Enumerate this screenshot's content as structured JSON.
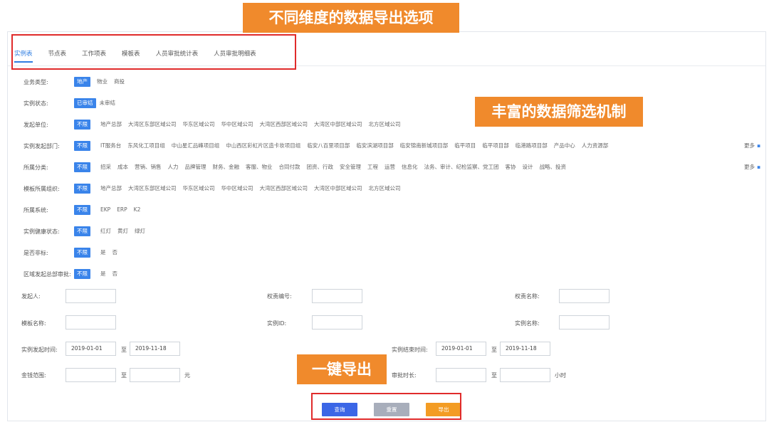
{
  "callouts": {
    "tabs_note": "不同维度的数据导出选项",
    "filter_note": "丰富的数据筛选机制",
    "export_note": "一键导出"
  },
  "tabs": [
    "实例表",
    "节点表",
    "工作项表",
    "模板表",
    "人员审批统计表",
    "人员审批明细表"
  ],
  "filters": {
    "business_type": {
      "label": "业务类型:",
      "options": [
        "地产",
        "物业",
        "商投"
      ]
    },
    "instance_status": {
      "label": "实例状态:",
      "options": [
        "已审结",
        "未审结"
      ]
    },
    "initiator_unit": {
      "label": "发起单位:",
      "options": [
        "不限",
        "地产总部",
        "大湾区东部区域公司",
        "华东区域公司",
        "华中区域公司",
        "大湾区西部区域公司",
        "大湾区中部区域公司",
        "北方区域公司"
      ]
    },
    "initiator_dept": {
      "label": "实例发起部门:",
      "options": [
        "不限",
        "IT服务台",
        "东风化工项目组",
        "中山星汇品峰项目组",
        "中山西区彩虹片区造卡妆项目组",
        "临安八百里项目部",
        "临安滨湖项目部",
        "临安锦南新城项目部",
        "临平项目",
        "临平项目部",
        "临港路项目部",
        "产品中心",
        "人力资源部"
      ],
      "more": "更多"
    },
    "category": {
      "label": "所属分类:",
      "options": [
        "不限",
        "招采",
        "成本",
        "营销、销售",
        "人力",
        "品牌管理",
        "财务、金融",
        "客服、物业",
        "合同付款",
        "团资、行政",
        "安全管理",
        "工程",
        "运营",
        "信息化",
        "法务、审计、纪检监察、党工团",
        "客协",
        "设计",
        "战略、投资"
      ],
      "more": "更多"
    },
    "template_org": {
      "label": "模板所属组织:",
      "options": [
        "不限",
        "地产总部",
        "大湾区东部区域公司",
        "华东区域公司",
        "华中区域公司",
        "大湾区西部区域公司",
        "大湾区中部区域公司",
        "北方区域公司"
      ]
    },
    "system": {
      "label": "所属系统:",
      "options": [
        "不限",
        "EKP",
        "ERP",
        "K2"
      ]
    },
    "health": {
      "label": "实例健康状态:",
      "options": [
        "不限",
        "红灯",
        "黄灯",
        "绿灯"
      ]
    },
    "is_standard": {
      "label": "是否非标:",
      "options": [
        "不限",
        "是",
        "否"
      ]
    },
    "hq_approval": {
      "label": "区域发起总部审批:",
      "options": [
        "不限",
        "是",
        "否"
      ]
    }
  },
  "form": {
    "initiator": {
      "label": "发起人:",
      "value": ""
    },
    "permission_no": {
      "label": "权责编号:",
      "value": ""
    },
    "permission_name": {
      "label": "权责名称:",
      "value": ""
    },
    "template_name": {
      "label": "模板名称:",
      "value": ""
    },
    "instance_id": {
      "label": "实例ID:",
      "value": ""
    },
    "instance_name": {
      "label": "实例名称:",
      "value": ""
    },
    "start_time": {
      "label": "实例发起时间:",
      "from": "2019-01-01",
      "to": "2019-11-18"
    },
    "end_time": {
      "label": "实例结束时间:",
      "from": "2019-01-01",
      "to": "2019-11-18"
    },
    "amount": {
      "label": "金钱范围:",
      "from": "",
      "to": "",
      "unit": "元"
    },
    "duration": {
      "label": "审批时长:",
      "from": "",
      "to": "",
      "unit": "小时"
    },
    "range_sep": "至"
  },
  "buttons": {
    "search": "查询",
    "reset": "重置",
    "export": "导出"
  },
  "colors": {
    "accent": "#3a84ea",
    "callout": "#f08a2c",
    "highlight": "#e02b2b",
    "export": "#f39c24"
  }
}
